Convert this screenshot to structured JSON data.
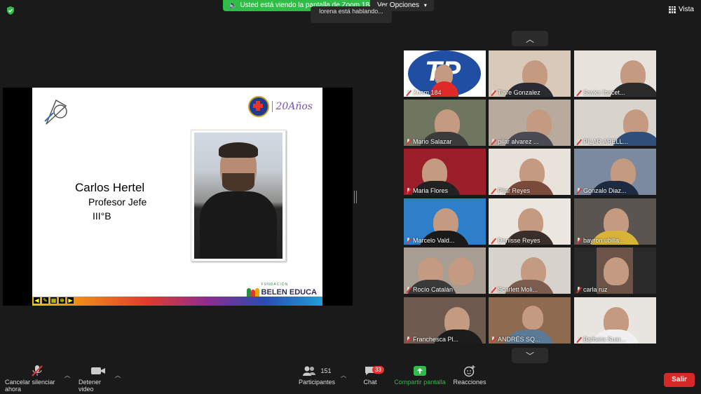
{
  "topbar": {
    "sharing_notice": "Usted está viendo la pantalla de Zoom 184",
    "view_options": "Ver Opciones",
    "speaking": "lorena está hablando...",
    "view_label": "Vista"
  },
  "slide": {
    "name": "Carlos Hertel",
    "role": "Profesor Jefe",
    "class": "III°B",
    "anniversary": "20Años",
    "brand_top": "FUNDACIÓN",
    "brand": "BELEN EDUCA"
  },
  "participants": [
    {
      "name": "Zoom 184"
    },
    {
      "name": "Tiare Gonzalez"
    },
    {
      "name": "Savka Ibacet..."
    },
    {
      "name": "Mario Salazar"
    },
    {
      "name": "pilar alvarez ..."
    },
    {
      "name": "PILAR ARELL..."
    },
    {
      "name": "Maria Flores"
    },
    {
      "name": "Pilar Reyes"
    },
    {
      "name": "Gonzalo Diaz..."
    },
    {
      "name": "Marcelo Vald..."
    },
    {
      "name": "Denisse Reyes"
    },
    {
      "name": "bayron ubilla..."
    },
    {
      "name": "Rocío Catalán"
    },
    {
      "name": "Scarlett Moli..."
    },
    {
      "name": "carla ruz"
    },
    {
      "name": "Franchesca Pl..."
    },
    {
      "name": "ANDRÉS SQ..."
    },
    {
      "name": "Barbara Suar..."
    }
  ],
  "toolbar": {
    "mute": "Cancelar silenciar ahora",
    "video": "Detener video",
    "participants": "Participantes",
    "participants_count": "151",
    "chat": "Chat",
    "chat_count": "33",
    "share": "Compartir pantalla",
    "reactions": "Reacciones",
    "leave": "Salir"
  },
  "colors": {
    "share_green": "#2fbd47",
    "leave_red": "#d72828"
  }
}
